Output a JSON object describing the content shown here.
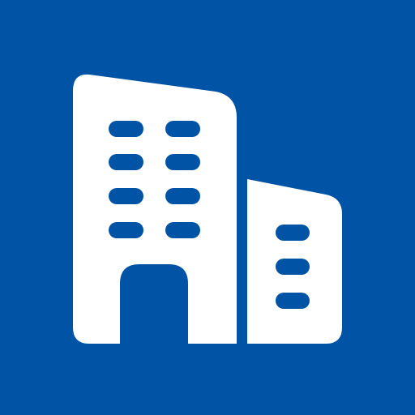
{
  "icon": {
    "name": "office-building-icon",
    "background_color": "#0153A5",
    "foreground_color": "#FFFFFF",
    "window_color": "#0153A5"
  }
}
